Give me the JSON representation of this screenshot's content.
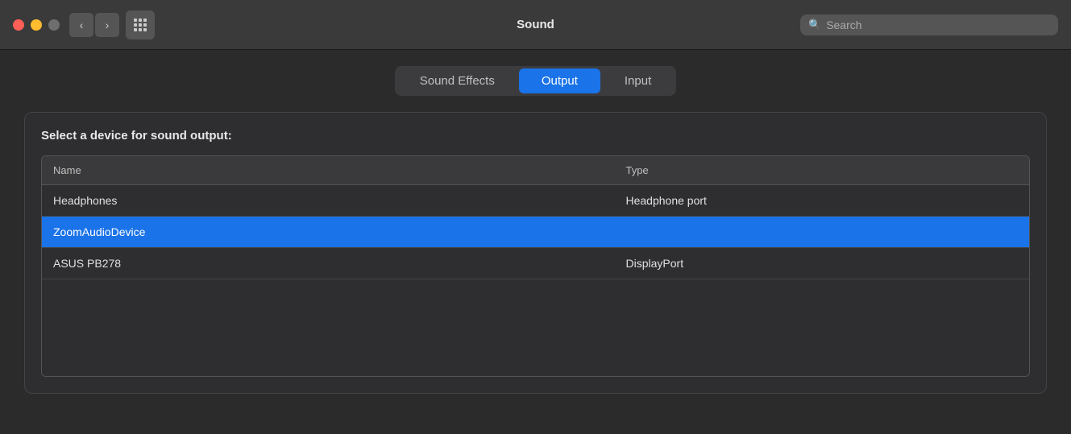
{
  "titlebar": {
    "title": "Sound",
    "search_placeholder": "Search",
    "back_icon": "‹",
    "forward_icon": "›"
  },
  "tabs": [
    {
      "id": "sound-effects",
      "label": "Sound Effects",
      "active": false
    },
    {
      "id": "output",
      "label": "Output",
      "active": true
    },
    {
      "id": "input",
      "label": "Input",
      "active": false
    }
  ],
  "section": {
    "title": "Select a device for sound output:"
  },
  "table": {
    "columns": [
      {
        "id": "name",
        "label": "Name"
      },
      {
        "id": "type",
        "label": "Type"
      }
    ],
    "rows": [
      {
        "name": "Headphones",
        "type": "Headphone port",
        "selected": false
      },
      {
        "name": "ZoomAudioDevice",
        "type": "",
        "selected": true
      },
      {
        "name": "ASUS PB278",
        "type": "DisplayPort",
        "selected": false
      }
    ]
  }
}
